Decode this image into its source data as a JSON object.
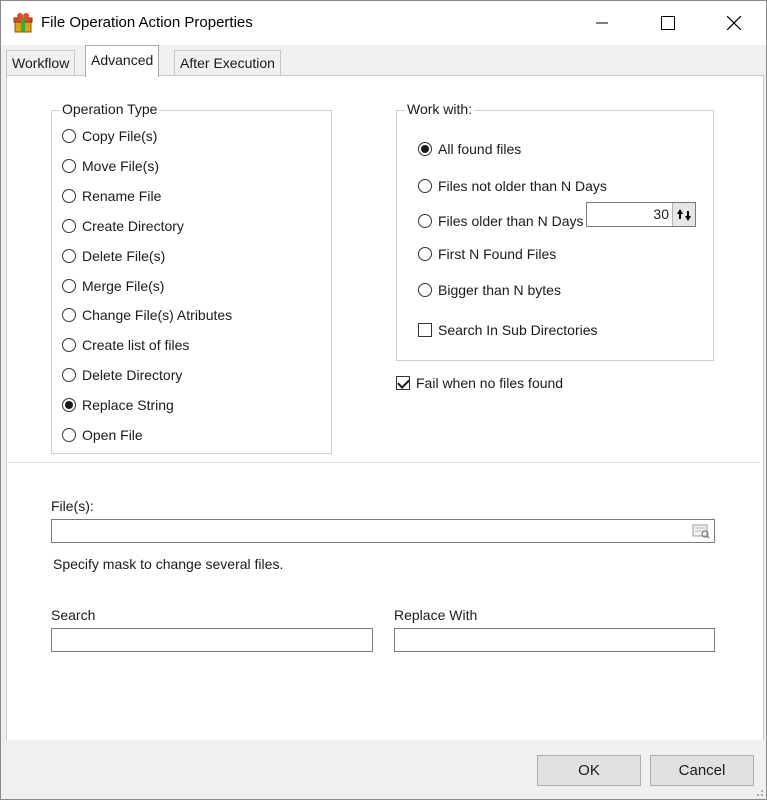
{
  "window": {
    "title": "File Operation Action Properties"
  },
  "tabs": [
    {
      "label": "Workflow"
    },
    {
      "label": "Advanced"
    },
    {
      "label": "After Execution"
    }
  ],
  "operation_type": {
    "legend": "Operation Type",
    "selected": "Replace String",
    "options": [
      "Copy File(s)",
      "Move File(s)",
      "Rename File",
      "Create Directory",
      "Delete File(s)",
      "Merge File(s)",
      "Change File(s) Atributes",
      "Create list of files",
      "Delete Directory",
      "Replace String",
      "Open File"
    ]
  },
  "work_with": {
    "legend": "Work with:",
    "selected": "All found files",
    "options": [
      "All found files",
      "Files not older than N Days",
      "Files older than N Days",
      "First N Found Files",
      "Bigger than N bytes"
    ],
    "n_value": "30",
    "search_sub_label": "Search In Sub Directories",
    "search_sub_checked": false
  },
  "fail_no_files": {
    "label": "Fail when no files found",
    "checked": true
  },
  "files": {
    "label": "File(s):",
    "value": "",
    "hint": "Specify mask to change several files."
  },
  "search": {
    "label": "Search",
    "value": ""
  },
  "replace": {
    "label": "Replace With",
    "value": ""
  },
  "buttons": {
    "ok": "OK",
    "cancel": "Cancel"
  },
  "icons": {
    "app": "gift-box-icon",
    "minimize": "minimize-icon",
    "maximize": "maximize-icon",
    "close": "close-icon",
    "browse": "folder-browse-icon",
    "spin": "updown-arrows-icon"
  }
}
